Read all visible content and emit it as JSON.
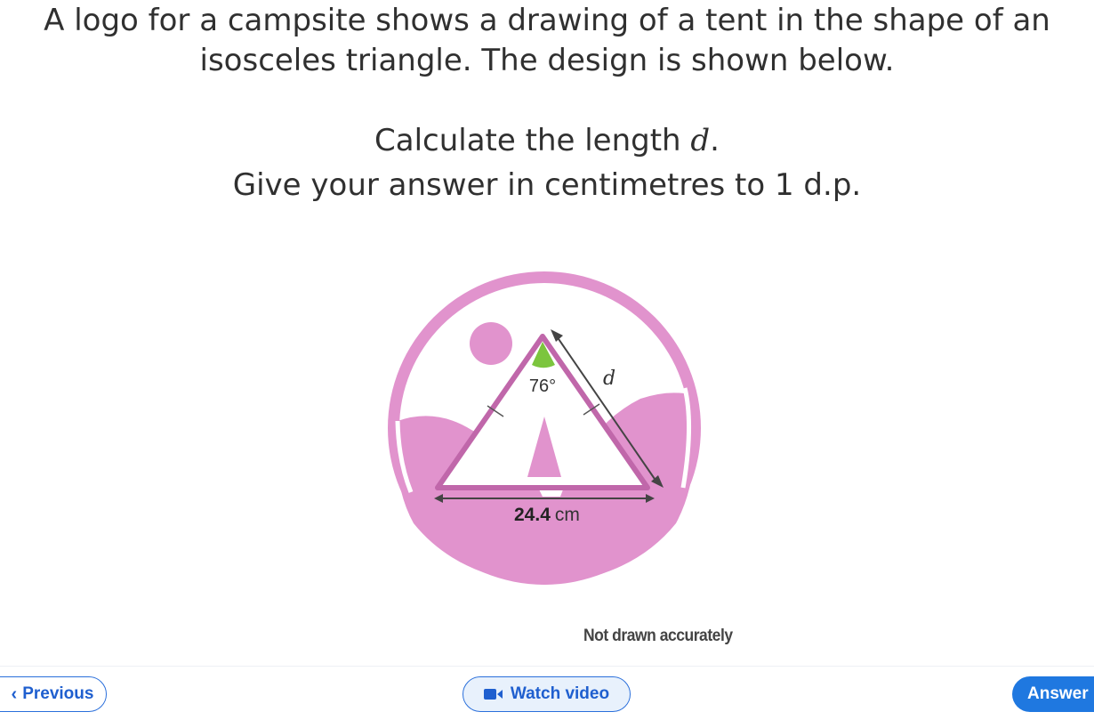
{
  "question": {
    "line1": "A logo for a campsite shows a drawing of a tent in the shape of an",
    "line2": "isosceles triangle. The design is shown below.",
    "line3_prefix": "Calculate the length ",
    "line3_var": "d",
    "line3_suffix": ".",
    "line4": "Give your answer in centimetres to 1 d.p."
  },
  "diagram": {
    "angle_label": "76°",
    "side_label": "d",
    "base_value": "24.4",
    "base_unit": "cm",
    "colors": {
      "pink": "#e193cd",
      "pink_dark": "#c067aa",
      "angle_green": "#7cc53e",
      "arrow_gray": "#444444"
    }
  },
  "caption": "Not drawn accurately",
  "footer": {
    "previous_label": "Previous",
    "video_label": "Watch video",
    "answer_label": "Answer"
  }
}
